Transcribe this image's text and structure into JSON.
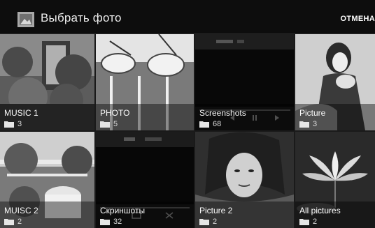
{
  "header": {
    "title": "Выбрать фото",
    "cancel_label": "ОТМЕНА"
  },
  "albums": [
    {
      "name": "MUSIC 1",
      "count": "3"
    },
    {
      "name": "PHOTO",
      "count": "5"
    },
    {
      "name": "Screenshots",
      "count": "68"
    },
    {
      "name": "Picture",
      "count": "3"
    },
    {
      "name": "MUISC 2",
      "count": "2"
    },
    {
      "name": "Скриншоты",
      "count": "32"
    },
    {
      "name": "Picture 2",
      "count": "2"
    },
    {
      "name": "All pictures",
      "count": "2"
    }
  ],
  "colors": {
    "header_bg": "#0d0d0d",
    "caption_bg": "rgba(0,0,0,0.42)",
    "text": "#fafafa"
  },
  "icons": {
    "app": "gallery-icon",
    "album": "folder-icon"
  }
}
